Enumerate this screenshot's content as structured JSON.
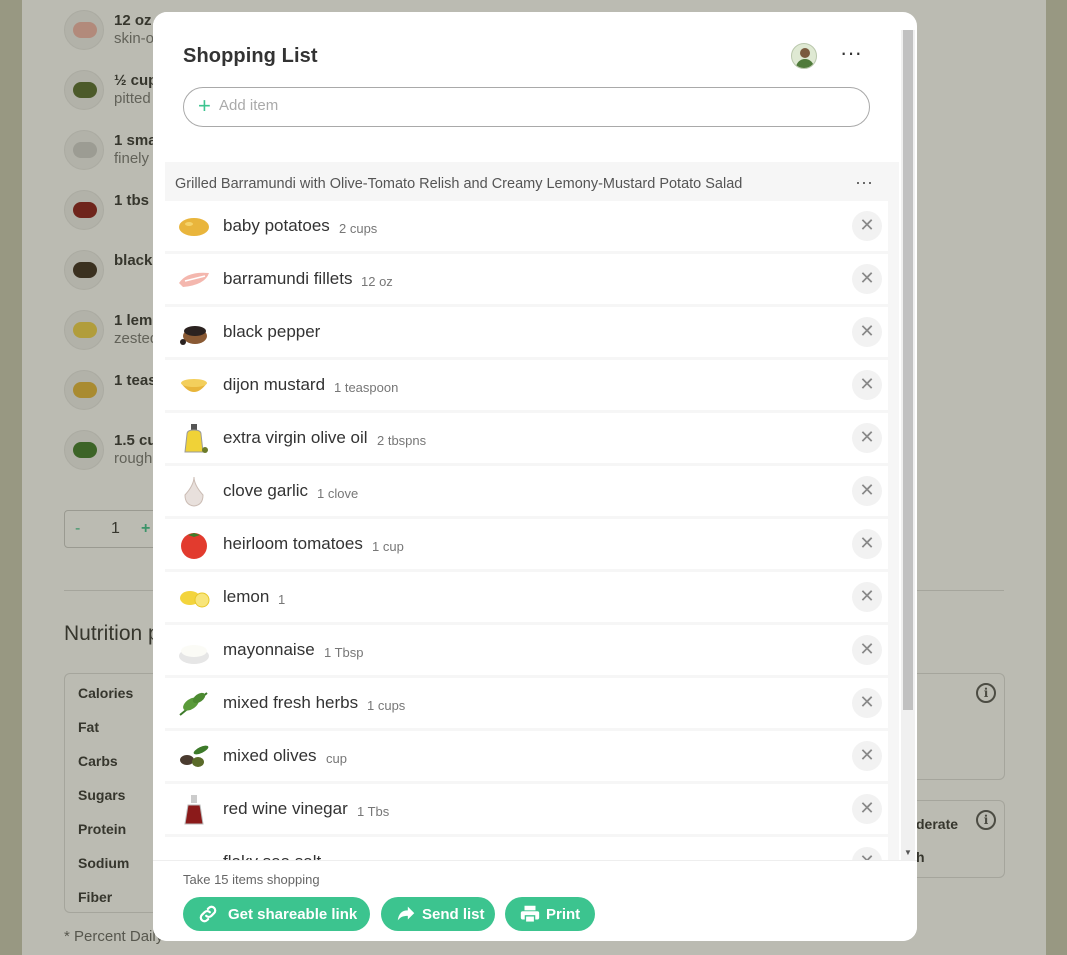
{
  "background": {
    "ingredients": [
      {
        "amount": "12 oz",
        "desc": "skin-o",
        "color": "#f2b4ab"
      },
      {
        "amount": "½ cup",
        "desc": "pitted",
        "color": "#556b2f"
      },
      {
        "amount": "1 sma",
        "desc": "finely",
        "color": "#cfcfcf"
      },
      {
        "amount": "1 tbs",
        "desc": "",
        "color": "#8b1a1a"
      },
      {
        "amount": "black",
        "desc": "",
        "color": "#3b2b20"
      },
      {
        "amount": "1 lem",
        "desc": "zested",
        "color": "#f0d24a"
      },
      {
        "amount": "1 teas",
        "desc": "",
        "color": "#e3b53a"
      },
      {
        "amount": "1.5 cu",
        "desc": "rough",
        "color": "#3d7a2a"
      }
    ],
    "stepper": {
      "minus": "-",
      "value": "1",
      "plus": "+"
    },
    "nutrition_title": "Nutrition p",
    "nutrition_labels": [
      "Calories",
      "Fat",
      "Carbs",
      "Sugars",
      "Protein",
      "Sodium",
      "Fiber"
    ],
    "box2_line1": "derate",
    "box2_line2": "h",
    "footnote": "* Percent Daily"
  },
  "modal": {
    "title": "Shopping List",
    "more_icon": "···",
    "add_placeholder": "Add item",
    "add_plus": "+",
    "recipe_title": "Grilled Barramundi with Olive-Tomato Relish and Creamy Lemony-Mustard Potato Salad",
    "recipe_more": "···",
    "items": [
      {
        "name": "baby potatoes",
        "qty": "2 cups",
        "icon": "potato-icon"
      },
      {
        "name": "barramundi fillets",
        "qty": "12 oz",
        "icon": "fish-fillet-icon"
      },
      {
        "name": "black pepper",
        "qty": "",
        "icon": "pepper-bowl-icon"
      },
      {
        "name": "dijon mustard",
        "qty": "1 teaspoon",
        "icon": "mustard-bowl-icon"
      },
      {
        "name": "extra virgin olive oil",
        "qty": "2 tbspns",
        "icon": "olive-oil-icon"
      },
      {
        "name": "clove garlic",
        "qty": "1 clove",
        "icon": "garlic-icon"
      },
      {
        "name": "heirloom tomatoes",
        "qty": "1 cup",
        "icon": "tomato-icon"
      },
      {
        "name": "lemon",
        "qty": "1",
        "icon": "lemon-icon"
      },
      {
        "name": "mayonnaise",
        "qty": "1 Tbsp",
        "icon": "mayonnaise-icon"
      },
      {
        "name": "mixed fresh herbs",
        "qty": "1 cups",
        "icon": "herbs-icon"
      },
      {
        "name": "mixed olives",
        "qty": "cup",
        "icon": "olives-icon"
      },
      {
        "name": "red wine vinegar",
        "qty": "1 Tbs",
        "icon": "vinegar-icon"
      },
      {
        "name": "flaky sea salt",
        "qty": "",
        "icon": "salt-icon"
      }
    ],
    "remove_icon": "✕",
    "footer_text": "Take 15 items shopping",
    "buttons": {
      "share": "Get shareable link",
      "send": "Send list",
      "print": "Print"
    },
    "accent": "#3cc48f"
  }
}
